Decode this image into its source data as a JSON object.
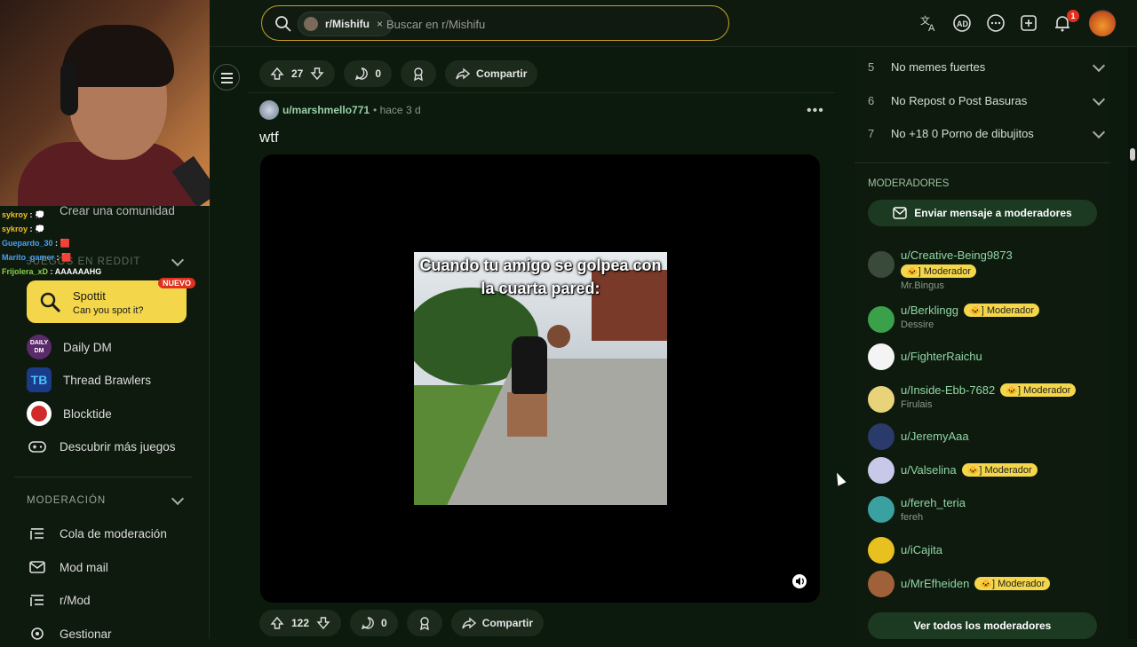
{
  "search": {
    "community_chip": "r/Mishifu",
    "chip_close": "×",
    "placeholder": "Buscar en r/Mishifu"
  },
  "header": {
    "notification_count": "1",
    "icons": [
      "translate-icon",
      "advertise-icon",
      "chat-icon",
      "create-post-icon",
      "notification-bell-icon",
      "user-avatar"
    ]
  },
  "chat": [
    {
      "user": "sykroy",
      "text": ": 💭"
    },
    {
      "user": "sykroy",
      "text": ": 💭"
    },
    {
      "user": "Guepardo_30",
      "text": ": 🟥"
    },
    {
      "user": "Marito_gamer",
      "text": ": 🟥"
    },
    {
      "user": "Frijolera_xD",
      "text": ": AAAAAAHG"
    }
  ],
  "sidebar": {
    "create_community": "Crear una comunidad",
    "games_header": "JUEGOS EN REDDIT",
    "spottit": {
      "title": "Spottit",
      "subtitle": "Can you spot it?",
      "badge": "NUEVO"
    },
    "games": [
      {
        "label": "Daily DM",
        "icon": "daily-dm-icon"
      },
      {
        "label": "Thread Brawlers",
        "icon": "thread-brawlers-icon"
      },
      {
        "label": "Blocktide",
        "icon": "blocktide-icon"
      },
      {
        "label": "Descubrir más juegos",
        "icon": "gamepad-icon"
      }
    ],
    "moderation_header": "MODERACIÓN",
    "moderation": [
      {
        "label": "Cola de moderación",
        "icon": "queue-icon"
      },
      {
        "label": "Mod mail",
        "icon": "mail-icon"
      },
      {
        "label": "r/Mod",
        "icon": "mod-icon"
      },
      {
        "label": "Gestionar",
        "icon": "settings-icon"
      }
    ]
  },
  "feed": {
    "prev_post": {
      "votes": "27",
      "comments": "0",
      "share": "Compartir"
    },
    "post": {
      "author": "u/marshmello771",
      "time": "• hace 3 d",
      "title": "wtf",
      "video_caption": "Cuando tu amigo se golpea con la cuarta pared:",
      "votes": "122",
      "comments": "0",
      "share": "Compartir"
    }
  },
  "rules": [
    {
      "n": "5",
      "label": "No memes fuertes"
    },
    {
      "n": "6",
      "label": "No Repost o Post Basuras"
    },
    {
      "n": "7",
      "label": "No +18 0 Porno de dibujitos"
    }
  ],
  "moderators": {
    "header": "MODERADORES",
    "message_button": "Enviar mensaje a moderadores",
    "view_all": "Ver todos los moderadores",
    "list": [
      {
        "user": "u/Creative-Being9873",
        "flair": "🐱] Moderador",
        "sub": "Mr.Bingus",
        "color": "#3a4a3a"
      },
      {
        "user": "u/Berklingg",
        "flair": "🐱] Moderador",
        "sub": "Dessire",
        "color": "#3aa04a"
      },
      {
        "user": "u/FighterRaichu",
        "flair": "",
        "sub": "",
        "color": "#f4f4f4"
      },
      {
        "user": "u/Inside-Ebb-7682",
        "flair": "🐱] Moderador",
        "sub": "Firulais",
        "color": "#e8d27a"
      },
      {
        "user": "u/JeremyAaa",
        "flair": "",
        "sub": "",
        "color": "#2a3a6a"
      },
      {
        "user": "u/Valselina",
        "flair": "🐱] Moderador",
        "sub": "",
        "color": "#c8c8e8"
      },
      {
        "user": "u/fereh_teria",
        "flair": "",
        "sub": "fereh",
        "color": "#3aa0a0"
      },
      {
        "user": "u/iCajita",
        "flair": "",
        "sub": "",
        "color": "#e8c020"
      },
      {
        "user": "u/MrEfheiden",
        "flair": "🐱] Moderador",
        "sub": "",
        "color": "#a0603a"
      }
    ]
  },
  "colors": {
    "accent_green": "#8fd6a4",
    "flair_yellow": "#f3d64a",
    "search_border": "#c9a227"
  }
}
